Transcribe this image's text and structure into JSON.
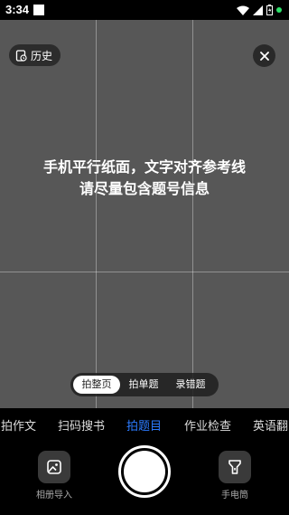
{
  "status_bar": {
    "time": "3:34",
    "icons": [
      "notification-square-icon",
      "wifi-icon",
      "signal-icon",
      "battery-icon",
      "camera-dot-icon"
    ],
    "dot_color": "#2ee06a"
  },
  "header": {
    "history_label": "历史",
    "history_icon": "history-icon",
    "close_icon": "close-icon"
  },
  "hint": {
    "line1": "手机平行纸面，文字对齐参考线",
    "line2": "请尽量包含题号信息"
  },
  "modes": {
    "items": [
      "拍整页",
      "拍单题",
      "录错题"
    ],
    "selected": "拍整页"
  },
  "tabs": {
    "items": [
      "拍作文",
      "扫码搜书",
      "拍题目",
      "作业检查",
      "英语翻"
    ],
    "selected": "拍题目",
    "accent_color": "#2c7bff"
  },
  "bottom_bar": {
    "album_label": "相册导入",
    "flashlight_label": "手电筒"
  }
}
